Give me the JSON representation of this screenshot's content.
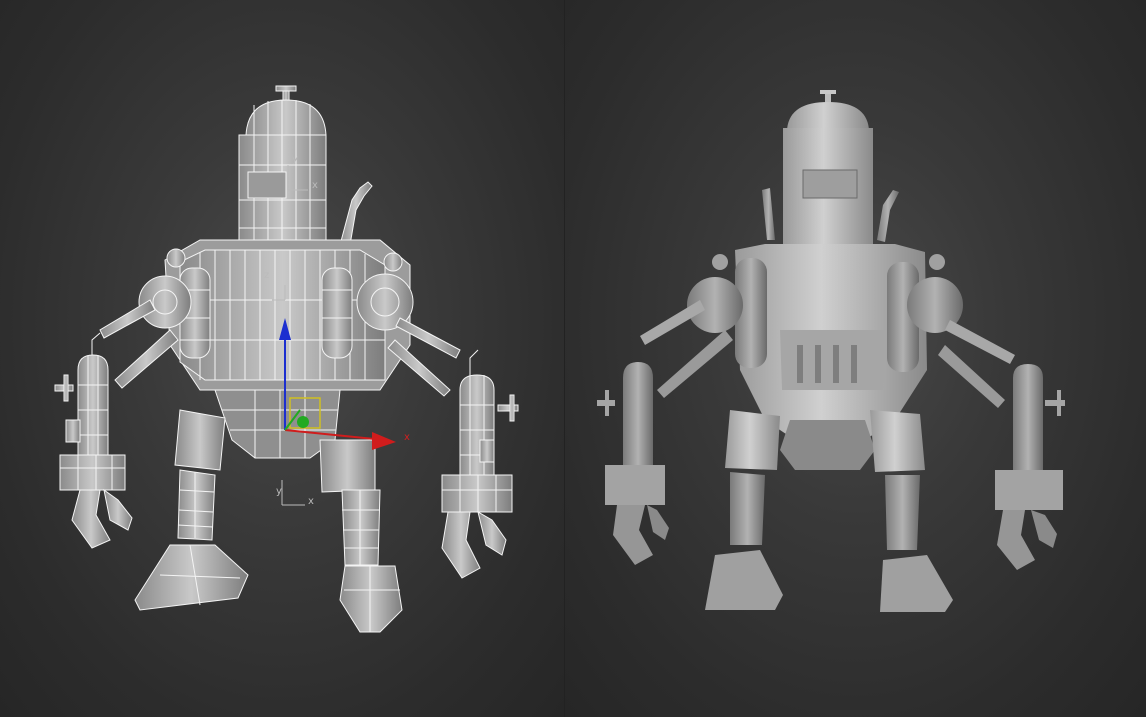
{
  "viewports": [
    {
      "id": "left",
      "render_mode": "wireframe-on-shaded",
      "model": "robot",
      "gizmo": {
        "type": "move",
        "axes": [
          "x",
          "y",
          "z"
        ],
        "colors": {
          "x": "#d01c1c",
          "y": "#22aa22",
          "z": "#1c2fd0",
          "plane": "#d0c020"
        }
      },
      "pivot_labels": [
        "y",
        "x",
        "z"
      ],
      "grid_axis_labels": {
        "y": "y",
        "x": "x"
      }
    },
    {
      "id": "right",
      "render_mode": "shaded",
      "model": "robot"
    }
  ],
  "colors": {
    "background": "#2b2b2b",
    "model_fill": "#a9a9a9",
    "model_light": "#d2d2d2",
    "model_dark": "#6f6f6f",
    "wire": "#f2f2f2"
  }
}
